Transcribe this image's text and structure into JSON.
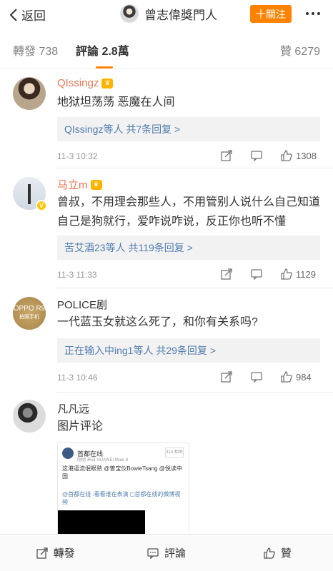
{
  "header": {
    "back_label": "返回",
    "title": "曾志偉獎門人",
    "follow_label": "十關注"
  },
  "tabs": {
    "repost": "轉發 738",
    "comments": "評論 2.8萬",
    "likes": "贊 6279"
  },
  "comments": [
    {
      "username": "QIssingz",
      "text": "地狱坦荡荡 恶魔在人间",
      "reply_summary": "QIssingz等人  共7条回复 >",
      "time": "11-3 10:32",
      "likes": "1308"
    },
    {
      "username": "马立m",
      "verified_badge": "V",
      "text": "曾叔，不用理会那些人，不用管别人说什么自己知道自己是狗就行，爱咋说咋说，反正你也听不懂",
      "reply_summary": "苦艾酒23等人  共119条回复 >",
      "time": "11-3 11:33",
      "likes": "1129"
    },
    {
      "username": "POLICE剧",
      "avatar_text": "OPPO R9",
      "avatar_subtext": "拍照手机",
      "text": "一代蓝玉女就这么死了，和你有关系吗?",
      "reply_summary": "正在输入中ing1等人  共29条回复 >",
      "time": "11-3 10:46",
      "likes": "984"
    },
    {
      "username": "凡凡远",
      "text": "图片评论",
      "image_preview": {
        "author": "首都在线",
        "meta": "刚刚  来自 HUAWEI Mate 8",
        "tag": "314 相关",
        "text": "这港逼流氓眼熟 @曾宝仪BowieTsang @悦读中国",
        "text2": "@首都在线 :看看谁在表演 ◻首都在线的微博视频"
      }
    }
  ],
  "bottom_bar": {
    "repost": "轉發",
    "comment": "評論",
    "like": "贊"
  },
  "colors": {
    "accent": "#ff8200",
    "username": "#eb7350",
    "link": "#507daf"
  }
}
